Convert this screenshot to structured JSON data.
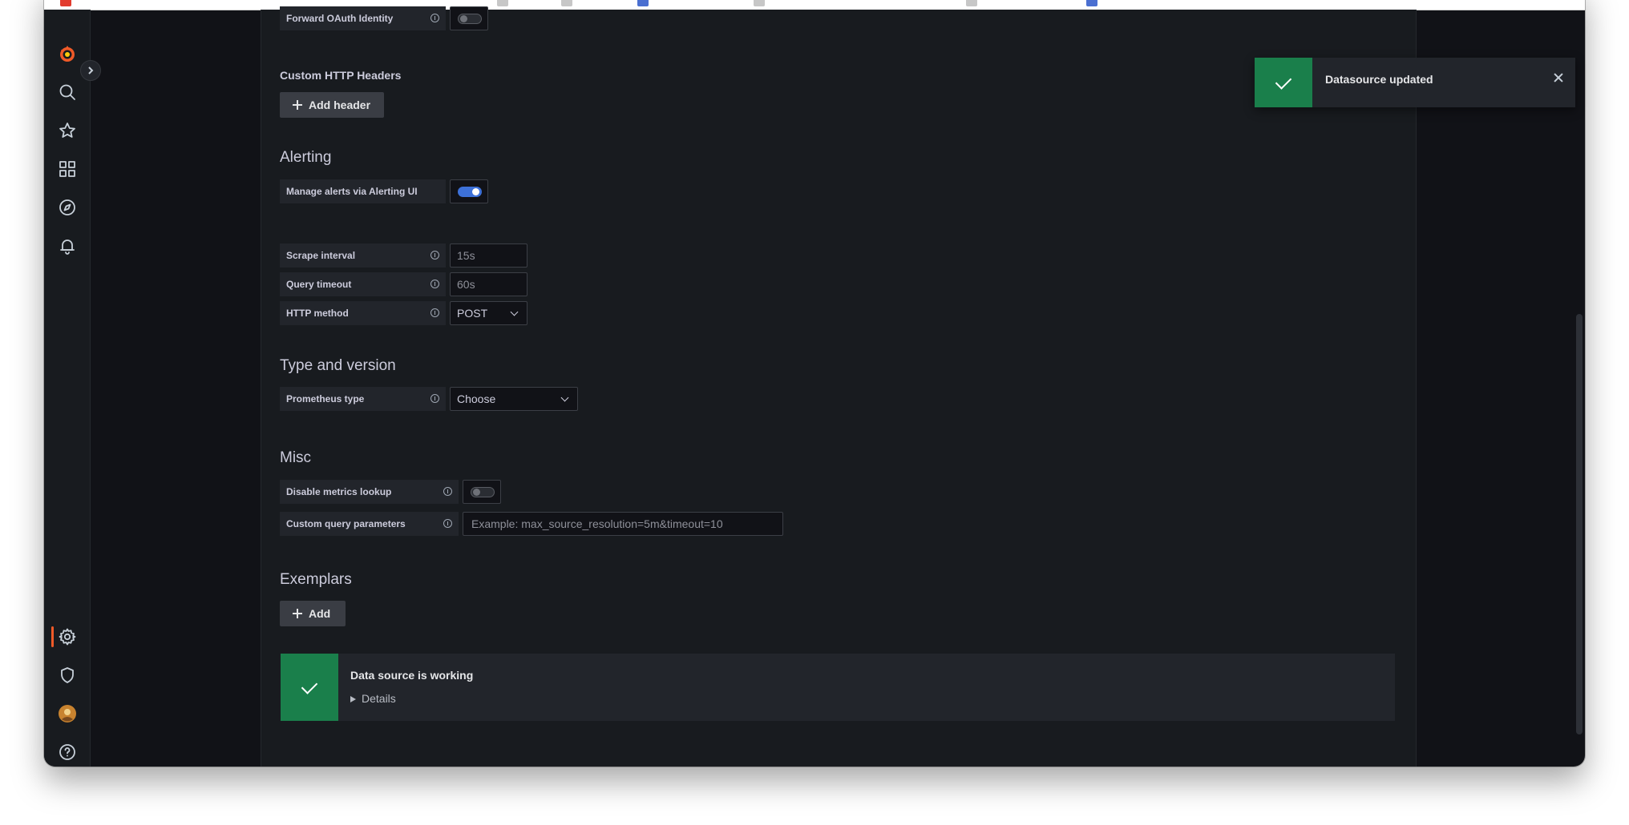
{
  "nav": {
    "items": [
      {
        "name": "grafana-logo-icon"
      },
      {
        "name": "search-icon"
      },
      {
        "name": "star-icon"
      },
      {
        "name": "dashboards-icon"
      },
      {
        "name": "explore-icon"
      },
      {
        "name": "alerting-bell-icon"
      },
      {
        "name": "configuration-gear-icon"
      },
      {
        "name": "server-admin-shield-icon"
      },
      {
        "name": "user-avatar"
      },
      {
        "name": "help-icon"
      }
    ],
    "active_item": "configuration",
    "accent_color": "#f05a28"
  },
  "auth": {
    "forward_oauth_label": "Forward OAuth Identity",
    "forward_oauth_enabled": false
  },
  "custom_headers": {
    "title": "Custom HTTP Headers",
    "add_button": "Add header"
  },
  "alerting": {
    "title": "Alerting",
    "manage_alerts_label": "Manage alerts via Alerting UI",
    "manage_alerts_enabled": true
  },
  "http": {
    "scrape_interval_label": "Scrape interval",
    "scrape_interval_placeholder": "15s",
    "query_timeout_label": "Query timeout",
    "query_timeout_placeholder": "60s",
    "method_label": "HTTP method",
    "method_value": "POST"
  },
  "type_version": {
    "title": "Type and version",
    "prometheus_type_label": "Prometheus type",
    "prometheus_type_value": "Choose"
  },
  "misc": {
    "title": "Misc",
    "disable_metrics_label": "Disable metrics lookup",
    "disable_metrics_enabled": false,
    "custom_query_label": "Custom query parameters",
    "custom_query_placeholder": "Example: max_source_resolution=5m&timeout=10"
  },
  "exemplars": {
    "title": "Exemplars",
    "add_button": "Add"
  },
  "status": {
    "title": "Data source is working",
    "details_label": "Details",
    "color": "#1a7f4b"
  },
  "toast": {
    "message": "Datasource updated",
    "color": "#1a7f4b"
  }
}
